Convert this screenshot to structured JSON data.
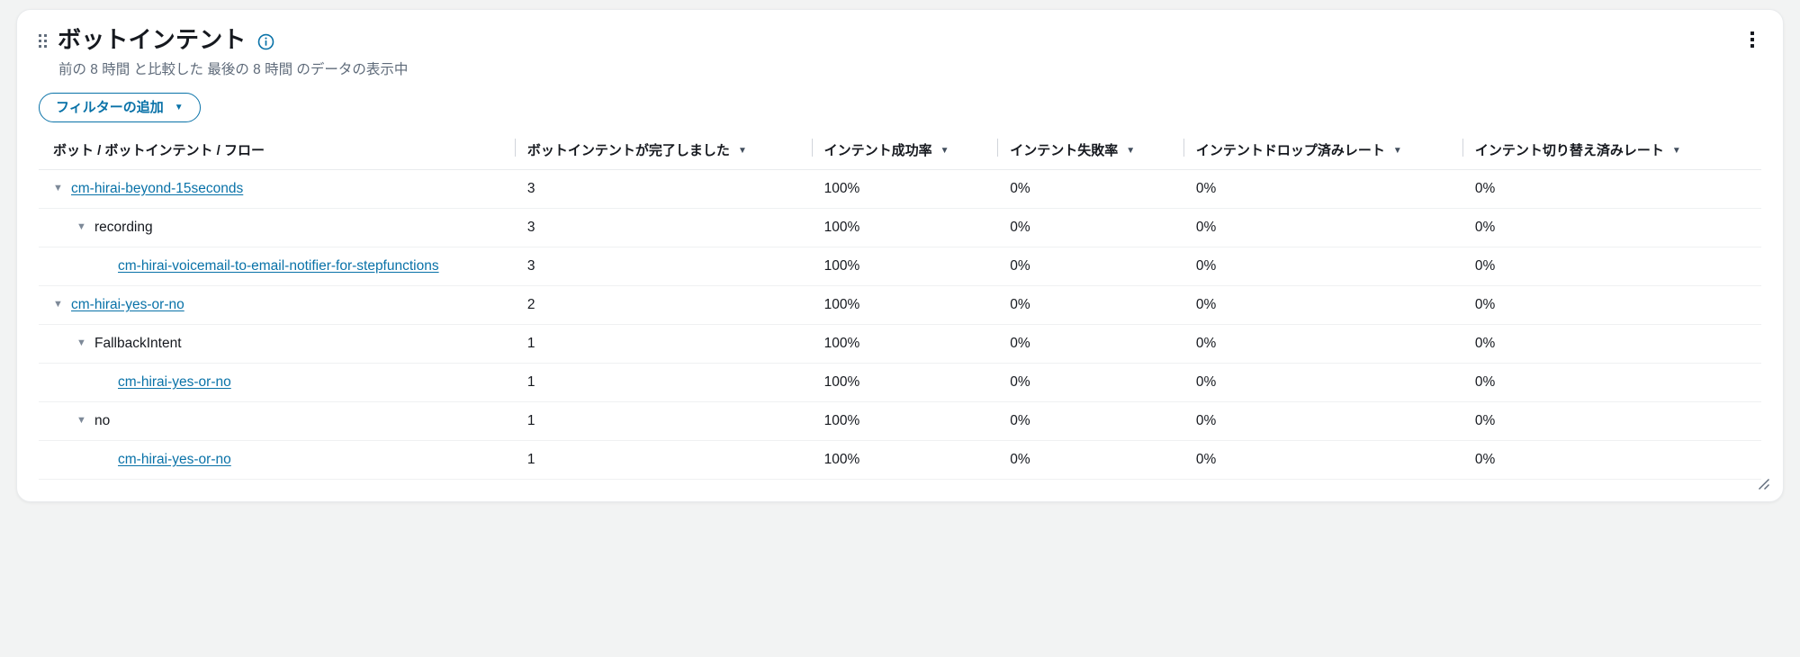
{
  "widget": {
    "title": "ボットインテント",
    "subtitle": "前の 8 時間 と比較した 最後の 8 時間 のデータの表示中",
    "drag_handle_name": "drag-handle",
    "info_icon_label": "i",
    "kebab_menu_label": "more-options"
  },
  "filter": {
    "label": "フィルターの追加",
    "caret": "▼"
  },
  "accent_colors": {
    "link": "#0972a8",
    "text": "#16191f",
    "muted": "#5f6b7a",
    "border": "#e9ebed"
  },
  "table": {
    "sort_caret": "▼",
    "expand_caret": "▼",
    "columns": [
      {
        "label": "ボット / ボットインテント / フロー",
        "sortable": false
      },
      {
        "label": "ボットインテントが完了しました",
        "sortable": true
      },
      {
        "label": "インテント成功率",
        "sortable": true
      },
      {
        "label": "インテント失敗率",
        "sortable": true
      },
      {
        "label": "インテントドロップ済みレート",
        "sortable": true
      },
      {
        "label": "インテント切り替え済みレート",
        "sortable": true
      }
    ],
    "rows": [
      {
        "name": "cm-hirai-beyond-15seconds",
        "level": 1,
        "is_link": true,
        "expandable": true,
        "completed": "3",
        "success_rate": "100%",
        "failure_rate": "0%",
        "dropped_rate": "0%",
        "switched_rate": "0%"
      },
      {
        "name": "recording",
        "level": 2,
        "is_link": false,
        "expandable": true,
        "completed": "3",
        "success_rate": "100%",
        "failure_rate": "0%",
        "dropped_rate": "0%",
        "switched_rate": "0%"
      },
      {
        "name": "cm-hirai-voicemail-to-email-notifier-for-stepfunctions",
        "level": 3,
        "is_link": true,
        "expandable": false,
        "completed": "3",
        "success_rate": "100%",
        "failure_rate": "0%",
        "dropped_rate": "0%",
        "switched_rate": "0%"
      },
      {
        "name": "cm-hirai-yes-or-no",
        "level": 1,
        "is_link": true,
        "expandable": true,
        "completed": "2",
        "success_rate": "100%",
        "failure_rate": "0%",
        "dropped_rate": "0%",
        "switched_rate": "0%"
      },
      {
        "name": "FallbackIntent",
        "level": 2,
        "is_link": false,
        "expandable": true,
        "completed": "1",
        "success_rate": "100%",
        "failure_rate": "0%",
        "dropped_rate": "0%",
        "switched_rate": "0%"
      },
      {
        "name": "cm-hirai-yes-or-no",
        "level": 3,
        "is_link": true,
        "expandable": false,
        "completed": "1",
        "success_rate": "100%",
        "failure_rate": "0%",
        "dropped_rate": "0%",
        "switched_rate": "0%"
      },
      {
        "name": "no",
        "level": 2,
        "is_link": false,
        "expandable": true,
        "completed": "1",
        "success_rate": "100%",
        "failure_rate": "0%",
        "dropped_rate": "0%",
        "switched_rate": "0%"
      },
      {
        "name": "cm-hirai-yes-or-no",
        "level": 3,
        "is_link": true,
        "expandable": false,
        "completed": "1",
        "success_rate": "100%",
        "failure_rate": "0%",
        "dropped_rate": "0%",
        "switched_rate": "0%"
      }
    ]
  }
}
